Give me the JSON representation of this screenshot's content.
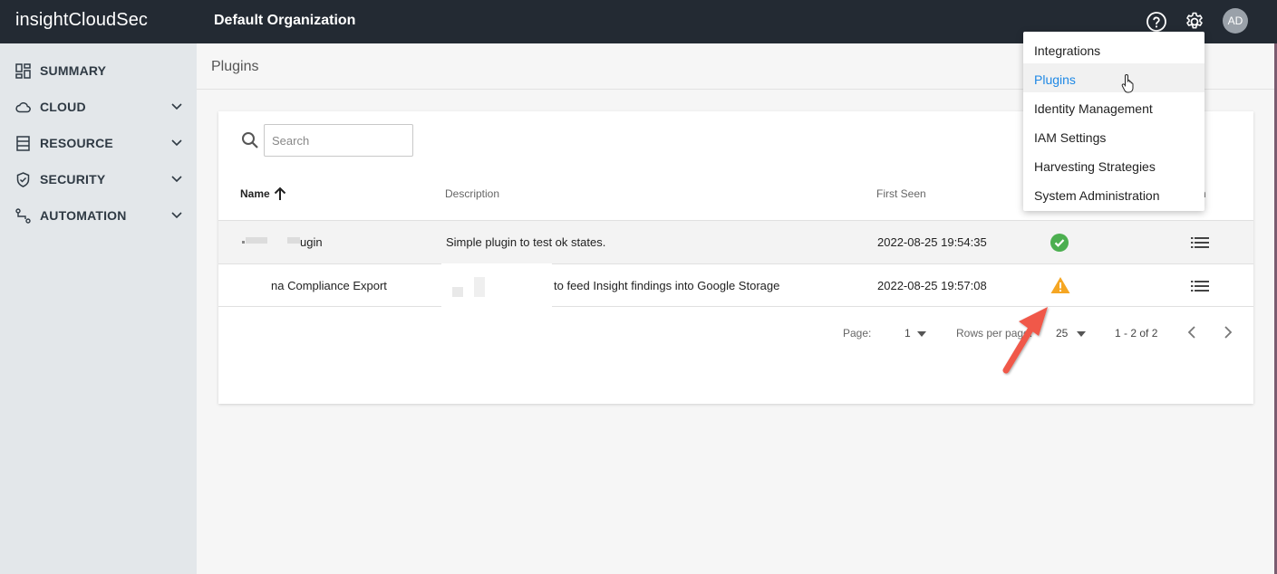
{
  "topbar": {
    "brand_prefix": "insight",
    "brand_suffix": "CloudSec",
    "organization": "Default Organization",
    "avatar_initials": "AD"
  },
  "sidebar": {
    "items": [
      {
        "label": "SUMMARY",
        "icon": "dashboard-icon",
        "expandable": false
      },
      {
        "label": "CLOUD",
        "icon": "cloud-icon",
        "expandable": true
      },
      {
        "label": "RESOURCE",
        "icon": "resource-icon",
        "expandable": true
      },
      {
        "label": "SECURITY",
        "icon": "shield-icon",
        "expandable": true
      },
      {
        "label": "AUTOMATION",
        "icon": "automation-icon",
        "expandable": true
      }
    ]
  },
  "page": {
    "title": "Plugins"
  },
  "search": {
    "placeholder": "Search",
    "value": ""
  },
  "table": {
    "headers": {
      "name": "Name",
      "description": "Description",
      "first_seen": "First Seen",
      "action_partial": "n"
    },
    "rows": [
      {
        "name": "ugin",
        "description": "Simple plugin to test ok states.",
        "first_seen": "2022-08-25 19:54:35",
        "status": "ok"
      },
      {
        "name": "na Compliance Export",
        "description": "to feed Insight findings into Google Storage",
        "first_seen": "2022-08-25 19:57:08",
        "status": "warning"
      }
    ]
  },
  "pagination": {
    "page_label": "Page:",
    "page_value": "1",
    "rows_label": "Rows per page:",
    "rows_value": "25",
    "range": "1 - 2 of 2"
  },
  "settings_menu": {
    "items": [
      "Integrations",
      "Plugins",
      "Identity Management",
      "IAM Settings",
      "Harvesting Strategies",
      "System Administration"
    ],
    "active_index": 1
  },
  "colors": {
    "topbar": "#232a33",
    "sidebar": "#e3e7ea",
    "accent_link": "#1e88e5",
    "status_ok": "#4caf50",
    "status_warning": "#f5a623",
    "annotation_arrow": "#f0584a"
  }
}
